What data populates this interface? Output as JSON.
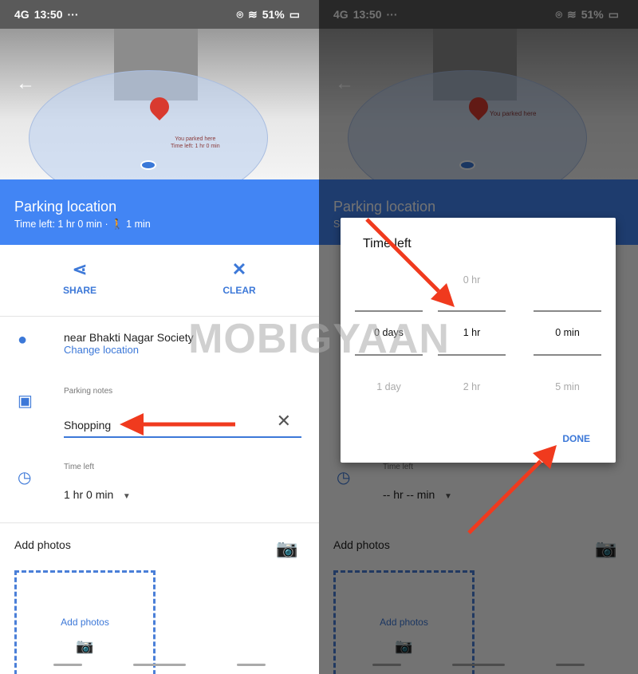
{
  "status_bar": {
    "network": "4G",
    "time": "13:50",
    "more": "···",
    "battery": "51%"
  },
  "map": {
    "label_left": [
      "You parked here",
      "Time left: 1 hr 0 min"
    ],
    "label_right": "You parked here"
  },
  "header": {
    "title": "Parking location",
    "subtitle_left": "Time left: 1 hr 0 min ·",
    "walk": "1 min",
    "subtitle_right_partial": "S"
  },
  "actions": {
    "share": "SHARE",
    "clear": "CLEAR"
  },
  "location": {
    "name": "near Bhakti Nagar Society",
    "change": "Change location"
  },
  "notes": {
    "label": "Parking notes",
    "value": "Shopping"
  },
  "time_left": {
    "label": "Time left",
    "value_left": "1 hr 0 min",
    "value_right": "-- hr -- min"
  },
  "photos": {
    "heading": "Add photos",
    "box_label": "Add photos"
  },
  "dialog": {
    "title": "Time left",
    "days": {
      "above": "",
      "selected": "0 days",
      "below": "1 day"
    },
    "hours": {
      "above": "0 hr",
      "selected": "1 hr",
      "below": "2 hr"
    },
    "minutes": {
      "above": "",
      "selected": "0 min",
      "below": "5 min"
    },
    "done": "DONE"
  },
  "watermark": "MOBIGYAAN",
  "colors": {
    "accent": "#4285f4",
    "link": "#3c78d8",
    "annotation_arrow": "#f03a1e",
    "pin": "#d93a2f"
  }
}
